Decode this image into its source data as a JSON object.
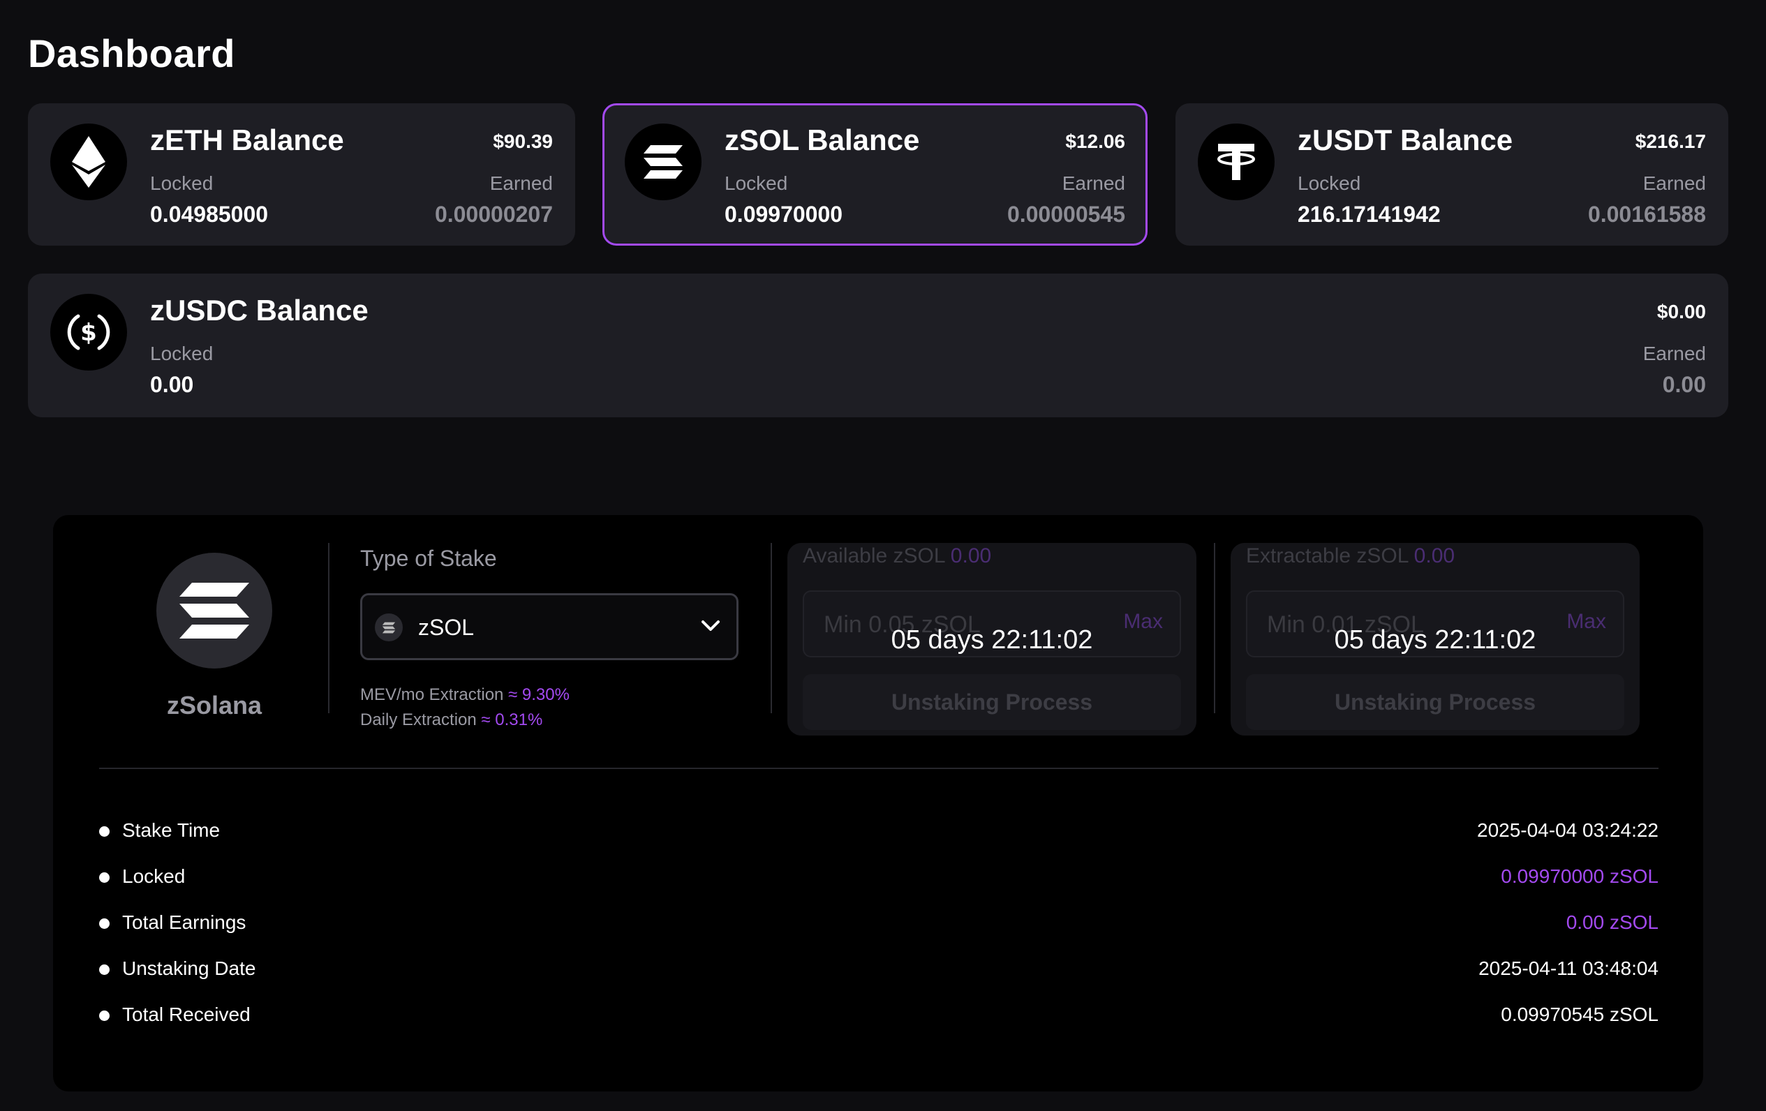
{
  "page": {
    "title": "Dashboard"
  },
  "balances": [
    {
      "name": "zETH Balance",
      "usd": "$90.39",
      "locked_label": "Locked",
      "locked": "0.04985000",
      "earned_label": "Earned",
      "earned": "0.00000207",
      "icon": "ethereum-icon"
    },
    {
      "name": "zSOL Balance",
      "usd": "$12.06",
      "locked_label": "Locked",
      "locked": "0.09970000",
      "earned_label": "Earned",
      "earned": "0.00000545",
      "icon": "solana-icon",
      "selected": true
    },
    {
      "name": "zUSDT Balance",
      "usd": "$216.17",
      "locked_label": "Locked",
      "locked": "216.17141942",
      "earned_label": "Earned",
      "earned": "0.00161588",
      "icon": "tether-icon"
    },
    {
      "name": "zUSDC Balance",
      "usd": "$0.00",
      "locked_label": "Locked",
      "locked": "0.00",
      "earned_label": "Earned",
      "earned": "0.00",
      "icon": "usdc-icon"
    }
  ],
  "stake": {
    "asset_name": "zSolana",
    "type_label": "Type of Stake",
    "selected_option": "zSOL",
    "mev_label": "MEV/mo Extraction",
    "mev_value": "≈ 9.30%",
    "daily_label": "Daily Extraction",
    "daily_value": "≈ 0.31%",
    "available": {
      "label": "Available zSOL",
      "amount": "0.00",
      "placeholder": "Min 0.05 zSOL",
      "max_label": "Max",
      "countdown": "05 days 22:11:02",
      "button": "Unstaking Process"
    },
    "extractable": {
      "label": "Extractable zSOL",
      "amount": "0.00",
      "placeholder": "Min 0.01 zSOL",
      "max_label": "Max",
      "countdown": "05 days 22:11:02",
      "button": "Unstaking Process"
    },
    "details": [
      {
        "label": "Stake Time",
        "value": "2025-04-04 03:24:22"
      },
      {
        "label": "Locked",
        "value": "0.09970000 zSOL",
        "accent": true
      },
      {
        "label": "Total Earnings",
        "value": "0.00 zSOL",
        "accent": true
      },
      {
        "label": "Unstaking Date",
        "value": "2025-04-11 03:48:04"
      },
      {
        "label": "Total Received",
        "value": "0.09970545 zSOL"
      }
    ]
  },
  "colors": {
    "accent": "#a34af0",
    "background": "#0d0d10",
    "card": "#1e1e24"
  }
}
